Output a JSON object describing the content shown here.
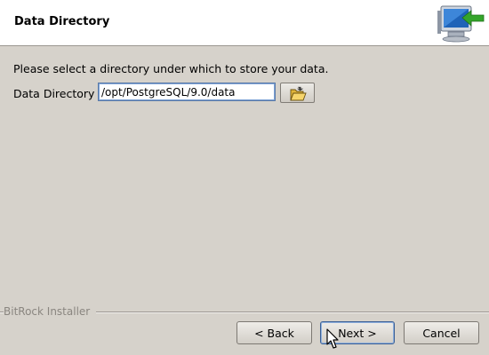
{
  "header": {
    "title": "Data Directory",
    "logo_icon": "installer-computer-arrow-icon"
  },
  "content": {
    "prompt": "Please select a directory under which to store your data.",
    "field_label": "Data Directory",
    "directory_value": "/opt/PostgreSQL/9.0/data",
    "browse_icon": "open-folder-icon"
  },
  "footer": {
    "brand": "BitRock Installer",
    "back_label": "< Back",
    "next_label": "Next >",
    "cancel_label": "Cancel"
  },
  "colors": {
    "background": "#d6d2cb",
    "header_background": "#ffffff",
    "focus_border": "#5a7aa8"
  }
}
